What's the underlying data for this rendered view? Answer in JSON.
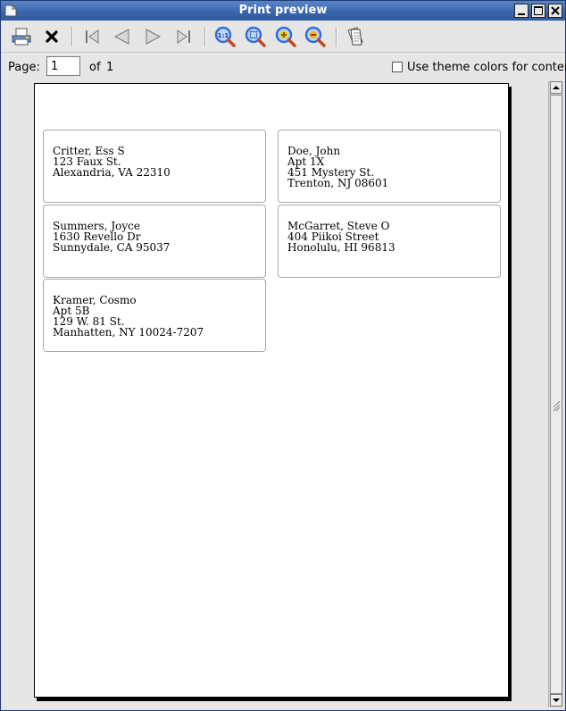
{
  "window": {
    "title": "Print preview"
  },
  "titlebar_buttons": [
    "minimize",
    "maximize",
    "close"
  ],
  "toolbar": {
    "tools": [
      {
        "name": "print-button",
        "icon": "printer-icon"
      },
      {
        "name": "close-preview-button",
        "icon": "close-x-icon"
      },
      {
        "name": "first-page-button",
        "icon": "first-page-icon"
      },
      {
        "name": "previous-page-button",
        "icon": "previous-page-icon"
      },
      {
        "name": "next-page-button",
        "icon": "next-page-icon"
      },
      {
        "name": "last-page-button",
        "icon": "last-page-icon"
      },
      {
        "name": "zoom-100-button",
        "icon": "zoom-actual-size-icon"
      },
      {
        "name": "zoom-fit-button",
        "icon": "zoom-fit-icon"
      },
      {
        "name": "zoom-in-button",
        "icon": "zoom-in-icon"
      },
      {
        "name": "zoom-out-button",
        "icon": "zoom-out-icon"
      },
      {
        "name": "page-setup-button",
        "icon": "pages-icon"
      }
    ],
    "zoom_actual_text": "1:1"
  },
  "pagebar": {
    "page_label": "Page:",
    "page_value": "1",
    "of_label": "of",
    "total_pages": "1",
    "theme_checkbox_label": "Use theme colors for content",
    "theme_checkbox_checked": false
  },
  "labels": [
    {
      "lines": [
        "Critter, Ess S",
        "123 Faux St.",
        "Alexandria, VA 22310"
      ]
    },
    {
      "lines": [
        "Doe, John",
        "Apt 1X",
        "451 Mystery St.",
        "Trenton, NJ 08601"
      ]
    },
    {
      "lines": [
        "Summers, Joyce",
        "1630 Revello Dr",
        "Sunnydale, CA 95037"
      ]
    },
    {
      "lines": [
        "McGarret, Steve O",
        "404 Piikoi Street",
        "Honolulu, HI 96813"
      ]
    },
    {
      "lines": [
        "Kramer, Cosmo",
        "Apt 5B",
        "129 W. 81 St.",
        "Manhatten, NY 10024-7207"
      ]
    }
  ],
  "colors": {
    "titlebar": "#3a66ad",
    "background": "#e6e6e6",
    "zoom_icon": "#2f6fd8",
    "zoom_plus": "#f2c21b",
    "zoom_minus": "#e04a2a"
  }
}
